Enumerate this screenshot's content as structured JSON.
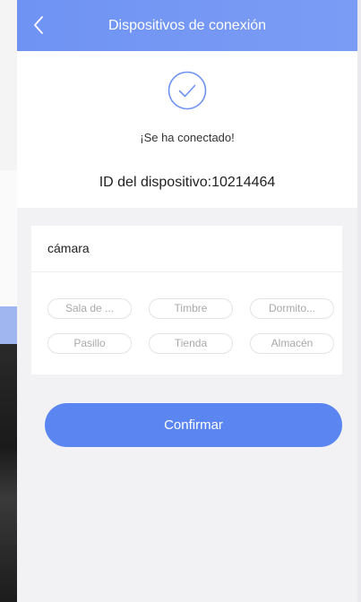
{
  "header": {
    "title": "Dispositivos de conexión"
  },
  "status": {
    "message": "¡Se ha conectado!",
    "device_id_label": "ID del dispositivo:10214464"
  },
  "device_name": {
    "value": "cámara"
  },
  "location_tags": [
    "Sala de ...",
    "Timbre",
    "Dormito...",
    "Pasillo",
    "Tienda",
    "Almacén"
  ],
  "actions": {
    "confirm_label": "Confirmar"
  },
  "colors": {
    "header_blue": "#7198f4",
    "accent_blue": "#5b86f1",
    "check_blue": "#6f93f3"
  }
}
